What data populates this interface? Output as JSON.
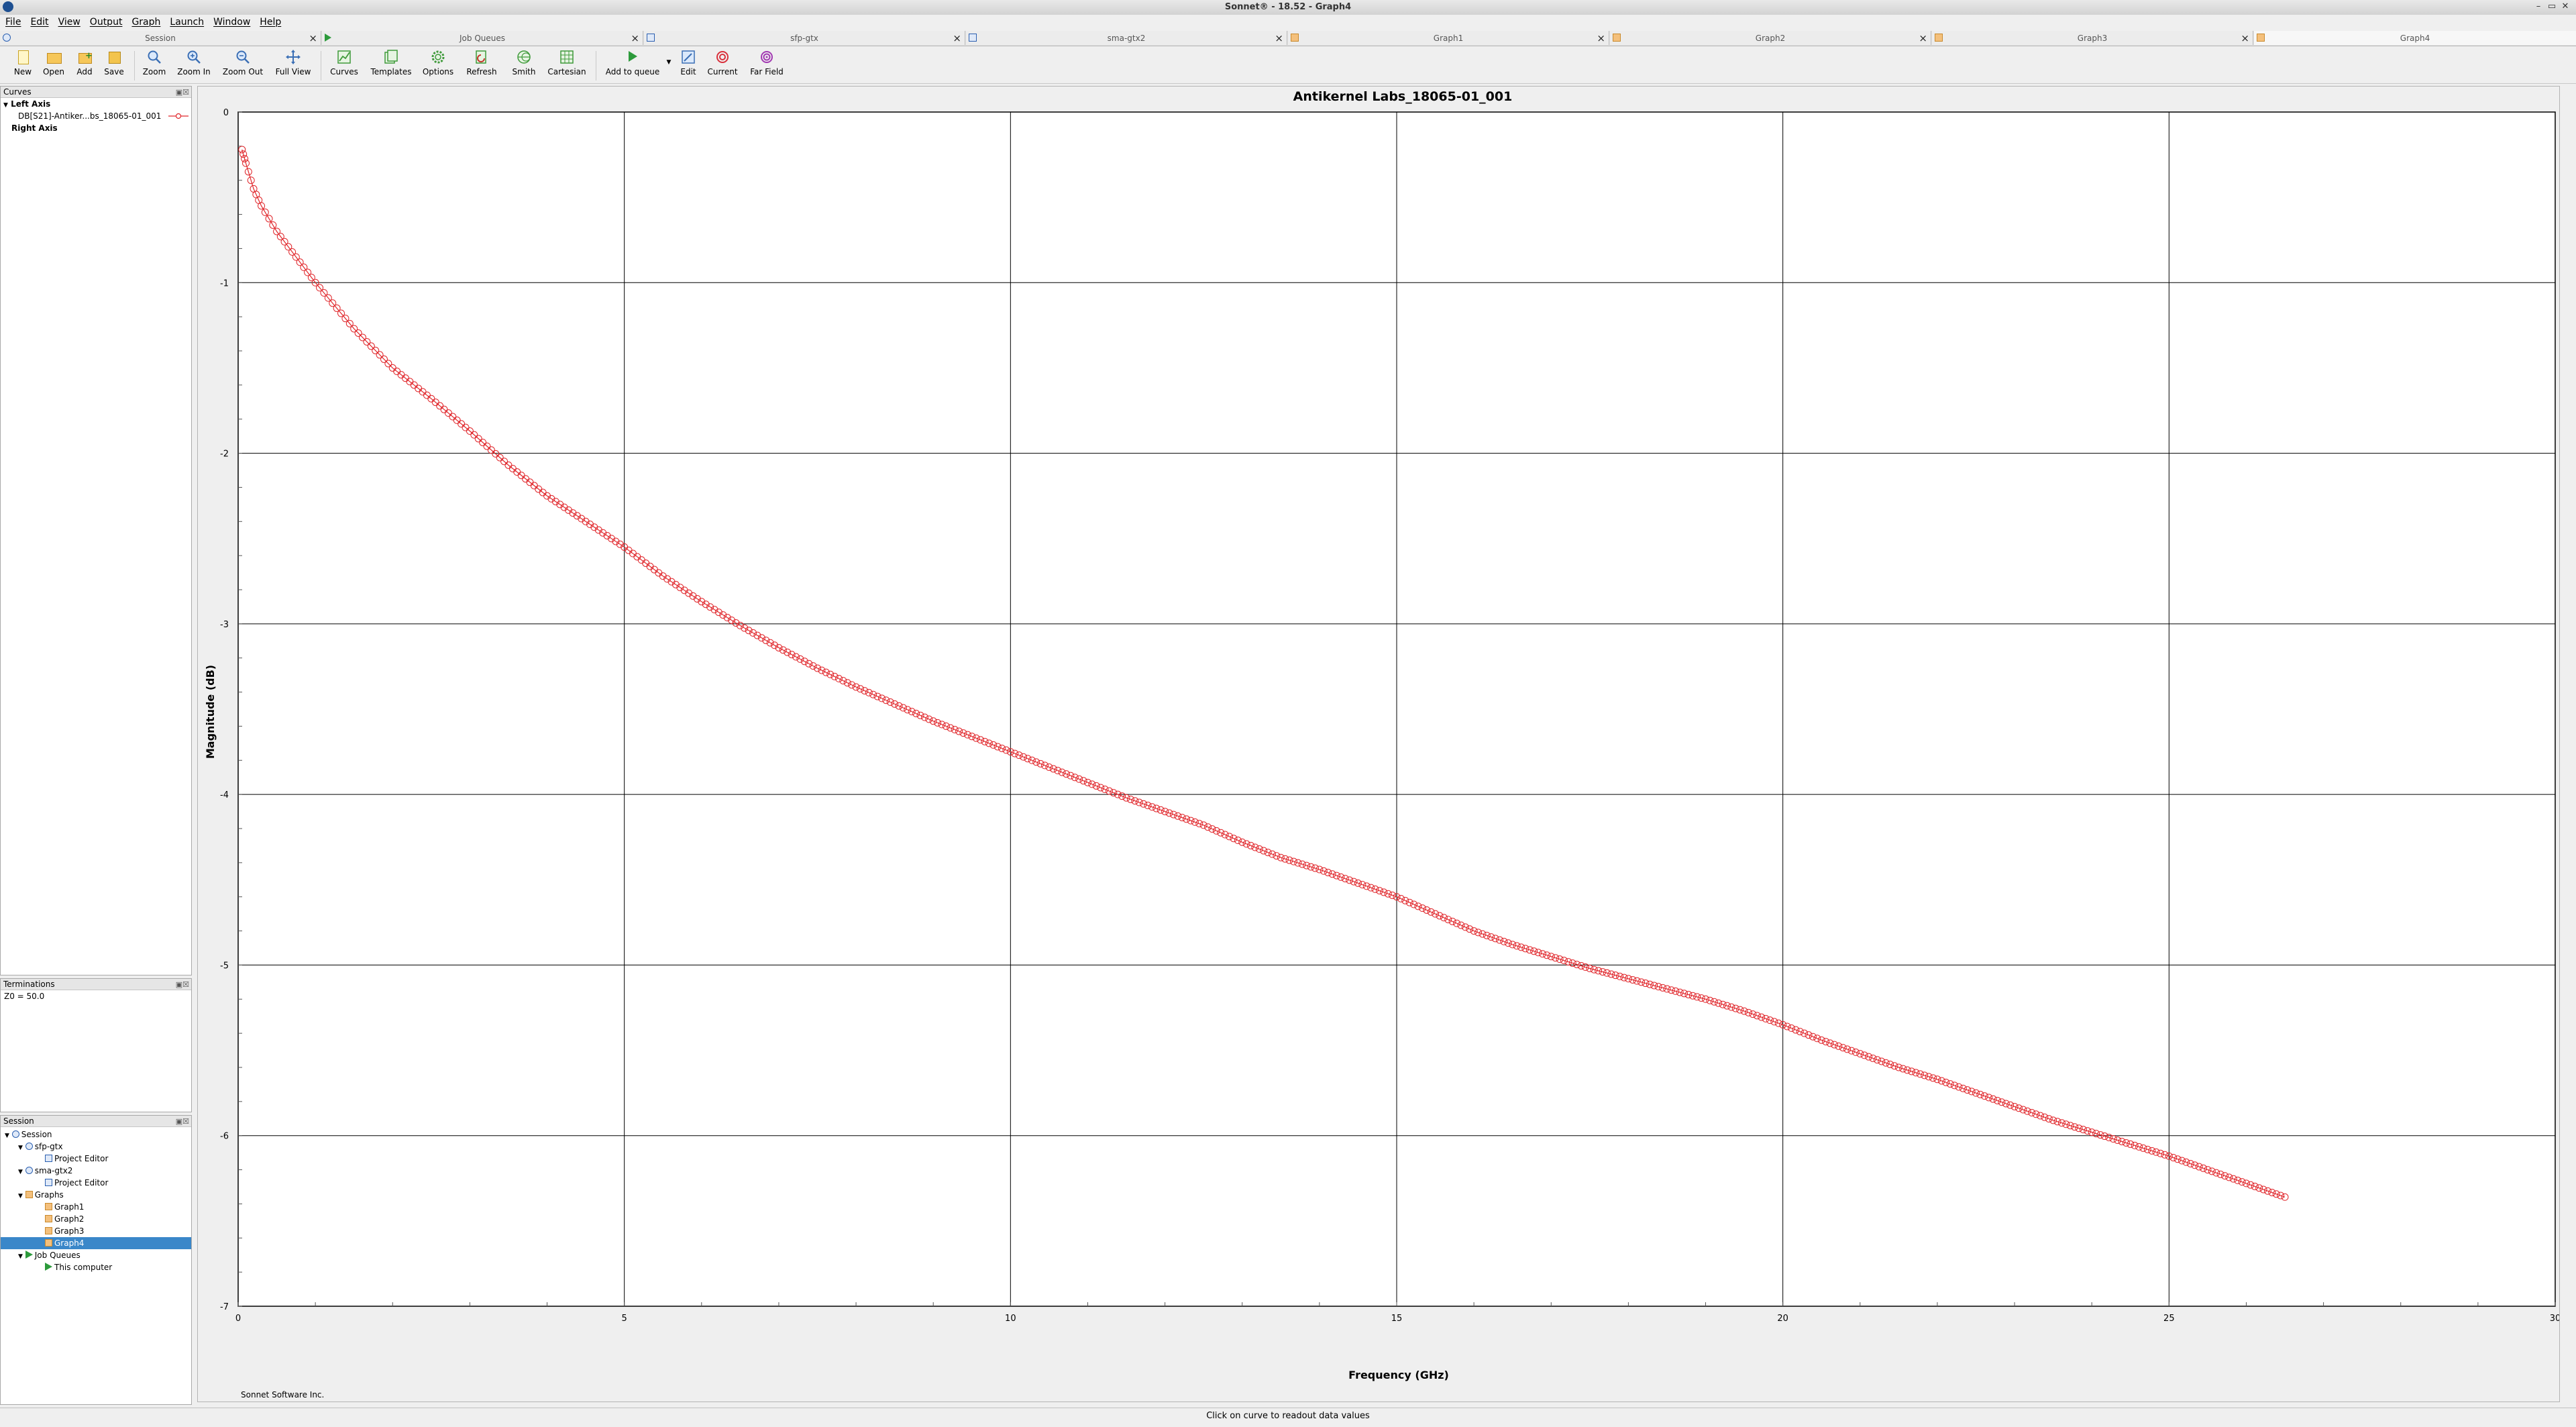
{
  "window": {
    "title": "Sonnet® - 18.52 - Graph4"
  },
  "menu": [
    "File",
    "Edit",
    "View",
    "Output",
    "Graph",
    "Launch",
    "Window",
    "Help"
  ],
  "tabs": [
    {
      "label": "Session",
      "icon": "session-icon"
    },
    {
      "label": "Job Queues",
      "icon": "job-queue-icon"
    },
    {
      "label": "sfp-gtx",
      "icon": "project-editor-icon"
    },
    {
      "label": "sma-gtx2",
      "icon": "project-editor-icon"
    },
    {
      "label": "Graph1",
      "icon": "graph-icon"
    },
    {
      "label": "Graph2",
      "icon": "graph-icon"
    },
    {
      "label": "Graph3",
      "icon": "graph-icon"
    },
    {
      "label": "Graph4",
      "icon": "graph-icon"
    }
  ],
  "toolbar": {
    "new": "New",
    "open": "Open",
    "add": "Add",
    "save": "Save",
    "zoom": "Zoom",
    "zoom_in": "Zoom In",
    "zoom_out": "Zoom Out",
    "full_view": "Full View",
    "curves": "Curves",
    "templates": "Templates",
    "options": "Options",
    "refresh": "Refresh",
    "smith": "Smith",
    "cartesian": "Cartesian",
    "add_to_queue": "Add to queue",
    "edit": "Edit",
    "current": "Current",
    "far_field": "Far Field"
  },
  "curves_panel": {
    "title": "Curves",
    "left_axis": "Left Axis",
    "curve_label": "DB[S21]-Antiker...bs_18065-01_001",
    "right_axis": "Right Axis"
  },
  "terminations_panel": {
    "title": "Terminations",
    "z0": "Z0 = 50.0"
  },
  "session_panel": {
    "title": "Session",
    "root": "Session",
    "project1": "sfp-gtx",
    "project1_editor": "Project Editor",
    "project2": "sma-gtx2",
    "project2_editor": "Project Editor",
    "graphs": "Graphs",
    "graph1": "Graph1",
    "graph2": "Graph2",
    "graph3": "Graph3",
    "graph4": "Graph4",
    "job_queues": "Job Queues",
    "this_computer": "This computer"
  },
  "footer_text": "Sonnet Software Inc.",
  "status_text": "Click on curve to readout data values",
  "colors": {
    "curve": "#e0262b",
    "selection": "#3a87c9"
  },
  "chart_data": {
    "type": "scatter",
    "title": "Antikernel Labs_18065-01_001",
    "xlabel": "Frequency (GHz)",
    "ylabel": "Magnitude (dB)",
    "xlim": [
      0,
      30
    ],
    "ylim": [
      -7,
      0
    ],
    "x_ticks": [
      0,
      5,
      10,
      15,
      20,
      25,
      30
    ],
    "y_ticks": [
      0,
      -1,
      -2,
      -3,
      -4,
      -5,
      -6,
      -7
    ],
    "grid": true,
    "marker": "open-circle",
    "series": [
      {
        "name": "DB[S21]-Antiker...bs_18065-01_001",
        "color": "#e0262b",
        "x": [
          0.05,
          0.1,
          0.2,
          0.3,
          0.5,
          0.75,
          1,
          1.5,
          2,
          2.5,
          3,
          3.5,
          4,
          4.5,
          5,
          5.5,
          6,
          6.5,
          7,
          7.5,
          8,
          8.5,
          9,
          9.5,
          10,
          10.5,
          11,
          11.5,
          12,
          12.5,
          13,
          13.5,
          14,
          14.5,
          15,
          15.5,
          16,
          16.5,
          17,
          17.5,
          18,
          18.5,
          19,
          19.5,
          20,
          20.5,
          21,
          21.5,
          22,
          22.5,
          23,
          23.5,
          24,
          24.5,
          25,
          25.5,
          26,
          26.5
        ],
        "y": [
          -0.22,
          -0.3,
          -0.45,
          -0.55,
          -0.7,
          -0.85,
          -1.0,
          -1.27,
          -1.5,
          -1.68,
          -1.87,
          -2.07,
          -2.25,
          -2.4,
          -2.55,
          -2.72,
          -2.87,
          -3.01,
          -3.14,
          -3.26,
          -3.37,
          -3.47,
          -3.57,
          -3.66,
          -3.75,
          -3.84,
          -3.93,
          -4.02,
          -4.1,
          -4.18,
          -4.28,
          -4.37,
          -4.44,
          -4.52,
          -4.6,
          -4.7,
          -4.8,
          -4.88,
          -4.95,
          -5.02,
          -5.08,
          -5.14,
          -5.2,
          -5.27,
          -5.35,
          -5.44,
          -5.52,
          -5.6,
          -5.67,
          -5.75,
          -5.83,
          -5.91,
          -5.98,
          -6.05,
          -6.12,
          -6.2,
          -6.28,
          -6.36
        ]
      }
    ]
  }
}
